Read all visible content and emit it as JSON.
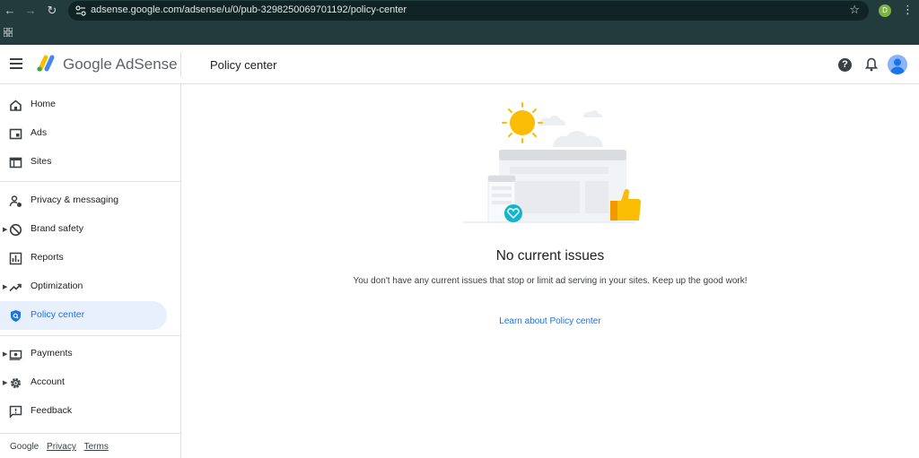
{
  "browser": {
    "url": "adsense.google.com/adsense/u/0/pub-3298250069701192/policy-center",
    "profile_initial": "D"
  },
  "header": {
    "brand": "Google AdSense",
    "page_title": "Policy center"
  },
  "sidebar": {
    "items": [
      {
        "label": "Home",
        "icon": "home-icon",
        "expandable": false
      },
      {
        "label": "Ads",
        "icon": "ads-icon",
        "expandable": false
      },
      {
        "label": "Sites",
        "icon": "sites-icon",
        "expandable": false
      },
      {
        "label": "Privacy & messaging",
        "icon": "privacy-icon",
        "expandable": false
      },
      {
        "label": "Brand safety",
        "icon": "block-icon",
        "expandable": true
      },
      {
        "label": "Reports",
        "icon": "reports-icon",
        "expandable": false
      },
      {
        "label": "Optimization",
        "icon": "trending-icon",
        "expandable": true
      },
      {
        "label": "Policy center",
        "icon": "shield-icon",
        "expandable": false,
        "active": true
      },
      {
        "label": "Payments",
        "icon": "payments-icon",
        "expandable": true
      },
      {
        "label": "Account",
        "icon": "gear-icon",
        "expandable": true
      },
      {
        "label": "Feedback",
        "icon": "feedback-icon",
        "expandable": false
      }
    ],
    "footer": {
      "google": "Google",
      "privacy": "Privacy",
      "terms": "Terms"
    }
  },
  "main": {
    "title": "No current issues",
    "description": "You don't have any current issues that stop or limit ad serving in your sites. Keep up the good work!",
    "link": "Learn about Policy center"
  },
  "colors": {
    "accent": "#1a73e8",
    "active_bg": "#e8f0fe",
    "chrome": "#223b3d"
  }
}
